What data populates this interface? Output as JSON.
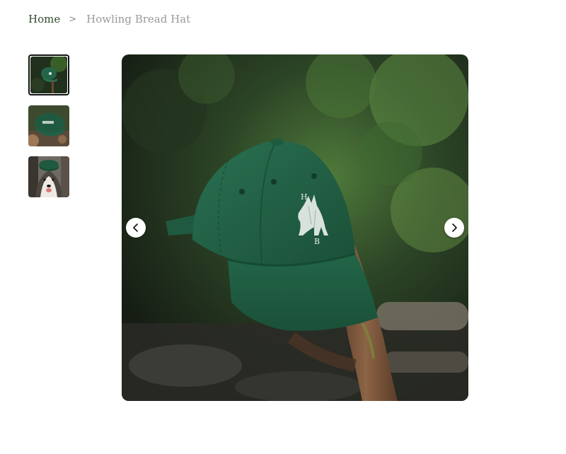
{
  "breadcrumb": {
    "home_label": "Home",
    "separator": ">",
    "current_label": "Howling Bread Hat"
  },
  "gallery": {
    "thumbnails": [
      {
        "subject": "green cap on branch",
        "active": true
      },
      {
        "subject": "green cap back view",
        "active": false
      },
      {
        "subject": "husky dog wearing cap",
        "active": false
      }
    ],
    "main_image": {
      "subject": "green embroidered baseball cap on a tree branch",
      "embroidery_letters": [
        "H",
        "B"
      ]
    },
    "prev_icon": "chevron-left-icon",
    "next_icon": "chevron-right-icon"
  },
  "colors": {
    "home_link": "#2f4a2b",
    "breadcrumb_current": "#9a9a9a",
    "cap_green": "#1f5a3e"
  }
}
